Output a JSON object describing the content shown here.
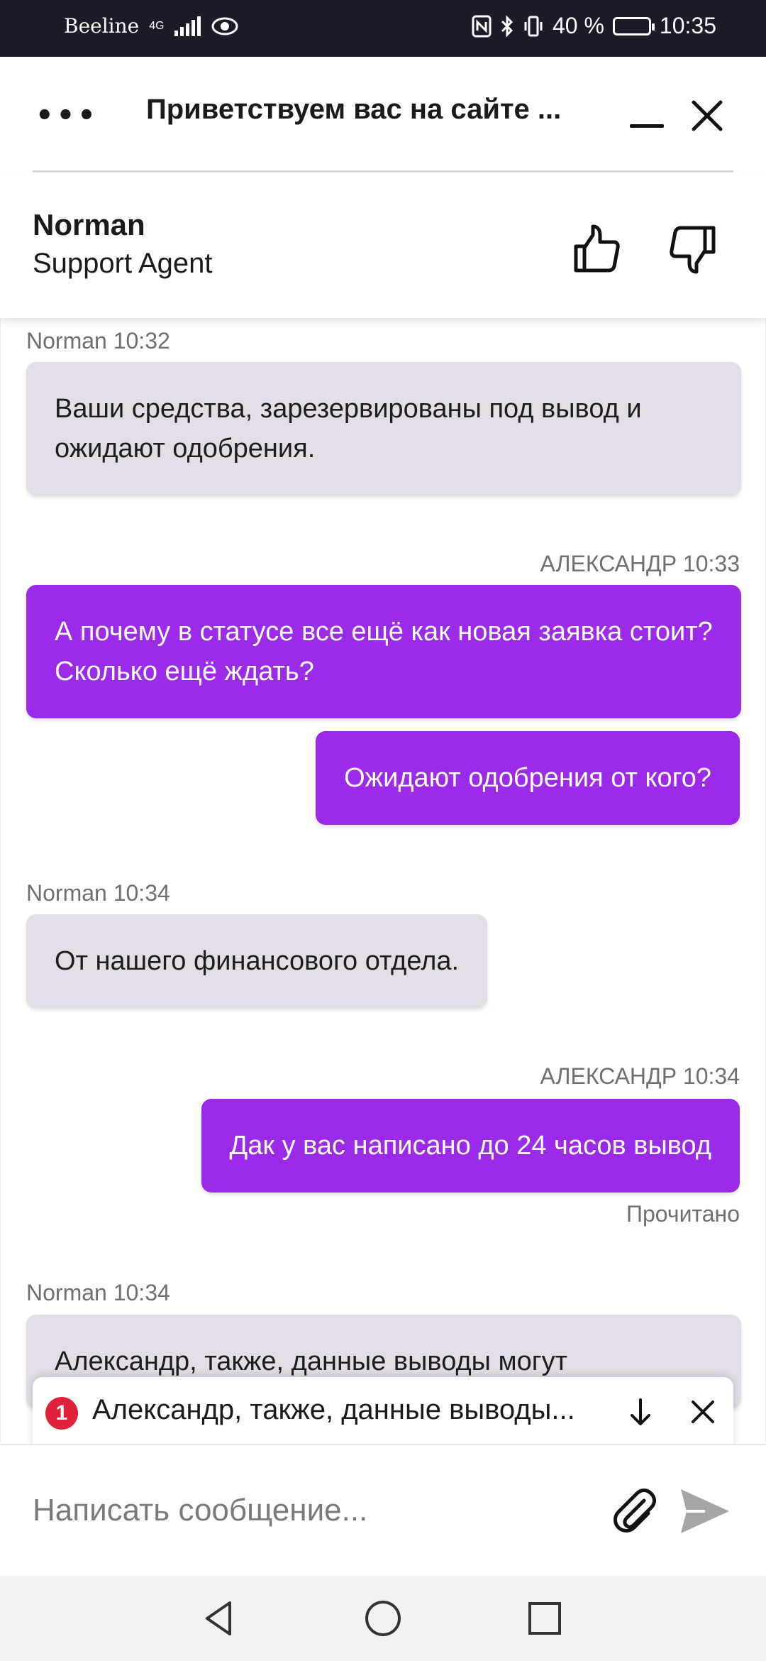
{
  "status_bar": {
    "carrier": "Beeline",
    "network": "4G",
    "battery_percent": "40 %",
    "time": "10:35"
  },
  "header": {
    "title": "Приветствуем вас на сайте ..."
  },
  "agent": {
    "name": "Norman",
    "role": "Support Agent"
  },
  "messages": [
    {
      "sender": "agent",
      "meta": "Norman 10:32",
      "text": "Ваши средства, зарезервированы под вывод и ожидают одобрения."
    },
    {
      "sender": "user",
      "meta": "АЛЕКСАНДР 10:33",
      "text": "А почему в статусе все ещё как новая заявка стоит? Сколько ещё ждать?"
    },
    {
      "sender": "user",
      "meta": "",
      "text": "Ожидают одобрения от кого?"
    },
    {
      "sender": "agent",
      "meta": "Norman 10:34",
      "text": "От нашего финансового отдела."
    },
    {
      "sender": "user",
      "meta": "АЛЕКСАНДР 10:34",
      "text": "Дак у вас написано до 24 часов вывод",
      "status": "Прочитано"
    },
    {
      "sender": "agent",
      "meta": "Norman 10:34",
      "text": "Александр, также, данные выводы могут"
    }
  ],
  "notification": {
    "count": "1",
    "text": "Александр, также, данные выводы..."
  },
  "composer": {
    "placeholder": "Написать сообщение..."
  },
  "colors": {
    "user_bubble": "#9b2be8",
    "agent_bubble": "#e2dde6",
    "badge": "#e0213a"
  }
}
